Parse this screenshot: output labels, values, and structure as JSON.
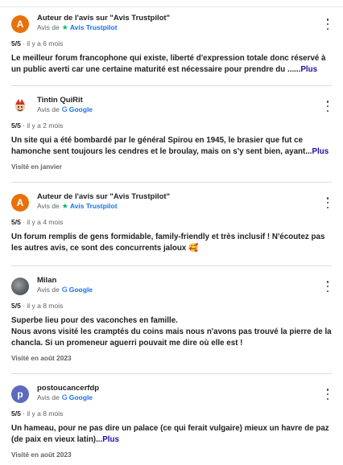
{
  "reviews": [
    {
      "author": "Auteur de l'avis sur \"Avis Trustpilot\"",
      "avatar_letter": "A",
      "avatar_color": "#e8710a",
      "via_prefix": "Avis de",
      "source_icon": "trustpilot-star-icon",
      "source_name": "Avis Trustpilot",
      "rating": "5/5",
      "age": " · il y a 6 mois",
      "text": "Le meilleur forum francophone qui existe, liberté d'expression totale donc réservé à un public averti car une certaine maturité est nécessaire pour prendre du ......",
      "more": "Plus"
    },
    {
      "author": "Tintin QuiRit",
      "via_prefix": "Avis de",
      "source_icon": "google-g-icon",
      "source_name": "Google",
      "rating": "5/5",
      "age": " · il y a 2 mois",
      "text": "Un site qui a été bombardé par le général Spirou en 1945, le brasier que fut ce hamonche sent toujours les cendres et le broulay, mais on s'y sent bien, ayant...",
      "more": "Plus",
      "visit": "Visité en janvier"
    },
    {
      "author": "Auteur de l'avis sur \"Avis Trustpilot\"",
      "avatar_letter": "A",
      "avatar_color": "#e8710a",
      "via_prefix": "Avis de",
      "source_icon": "trustpilot-star-icon",
      "source_name": "Avis Trustpilot",
      "rating": "5/5",
      "age": " · il y a 4 mois",
      "text": "Un forum remplis de gens formidable, family-friendly et très inclusif ! N'écoutez pas les autres avis, ce sont des concurrents jaloux",
      "emoji": "🥰"
    },
    {
      "author": "Milan",
      "via_prefix": "Avis de",
      "source_icon": "google-g-icon",
      "source_name": "Google",
      "rating": "5/5",
      "age": " · il y a 8 mois",
      "text_line1": "Superbe lieu pour des vaconches en famille.",
      "text": "Nous avons visité les cramptés du coins mais nous n'avons pas trouvé la pierre de la chancla. Si un promeneur aguerri pouvait me dire où elle est !",
      "visit": "Visité en août 2023"
    },
    {
      "author": "postoucancerfdp",
      "avatar_letter": "p",
      "avatar_color": "#5c6bc0",
      "via_prefix": "Avis de",
      "source_icon": "google-g-icon",
      "source_name": "Google",
      "rating": "5/5",
      "age": " · il y a 8 mois",
      "text": "Un hameau, pour ne pas dire un palace (ce qui ferait vulgaire) mieux un havre de paz (de paix en vieux latin)...",
      "more": "Plus",
      "visit": "Visité en août 2023"
    }
  ]
}
